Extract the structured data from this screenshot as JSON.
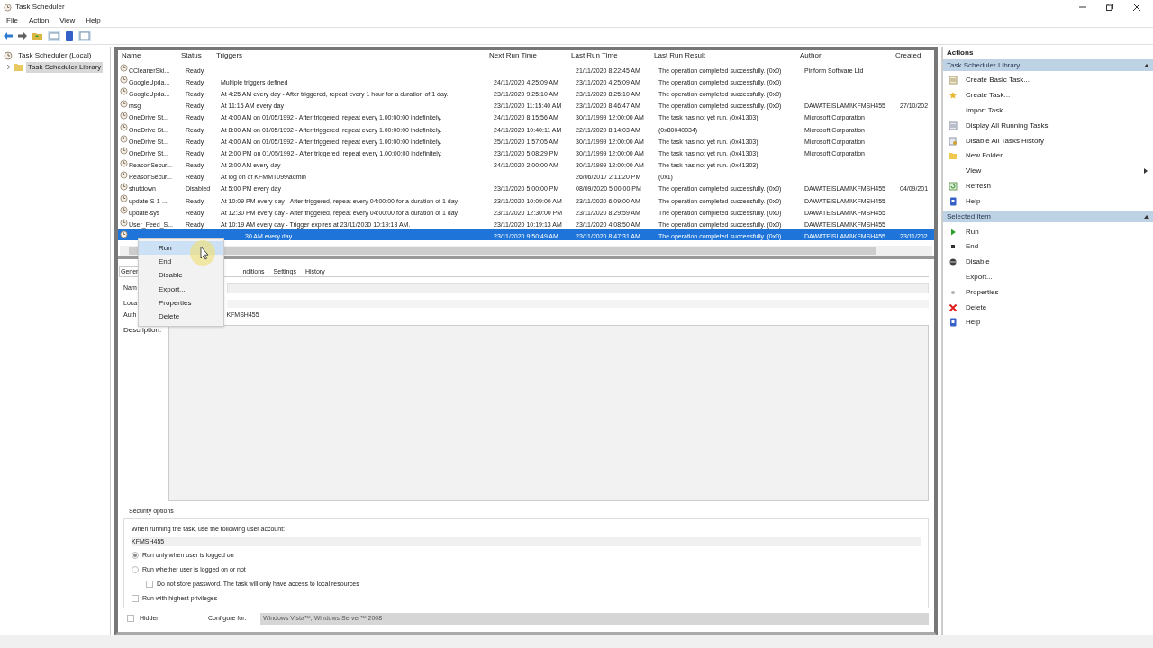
{
  "window": {
    "title": "Task Scheduler"
  },
  "menu": [
    "File",
    "Action",
    "View",
    "Help"
  ],
  "tree": [
    {
      "label": "Task Scheduler (Local)",
      "selected": false,
      "children": [
        {
          "label": "Task Scheduler Library",
          "selected": true
        }
      ]
    }
  ],
  "table": {
    "columns": [
      "Name",
      "Status",
      "Triggers",
      "Next Run Time",
      "Last Run Time",
      "Last Run Result",
      "Author",
      "Created"
    ],
    "rows": [
      {
        "selected": false,
        "cells": [
          "CCleanerSki...",
          "Ready",
          "",
          "",
          "21/11/2020 8:22:45 AM",
          "The operation completed successfully. (0x0)",
          "Piriform Software Ltd",
          ""
        ]
      },
      {
        "selected": false,
        "cells": [
          "GoogleUpda...",
          "Ready",
          "Multiple triggers defined",
          "24/11/2020 4:25:09 AM",
          "23/11/2020 4:25:09 AM",
          "The operation completed successfully. (0x0)",
          "",
          ""
        ]
      },
      {
        "selected": false,
        "cells": [
          "GoogleUpda...",
          "Ready",
          "At 4:25 AM every day - After triggered, repeat every 1 hour for a duration of 1 day.",
          "23/11/2020 9:25:10 AM",
          "23/11/2020 8:25:10 AM",
          "The operation completed successfully. (0x0)",
          "",
          ""
        ]
      },
      {
        "selected": false,
        "cells": [
          "msg",
          "Ready",
          "At 11:15 AM every day",
          "23/11/2020 11:15:40 AM",
          "23/11/2020 8:46:47 AM",
          "The operation completed successfully. (0x0)",
          "DAWATEISLAMI\\KFMSH455",
          "27/10/202"
        ]
      },
      {
        "selected": false,
        "cells": [
          "OneDrive St...",
          "Ready",
          "At 4:00 AM on 01/05/1992 - After triggered, repeat every 1.00:00:00 indefinitely.",
          "24/11/2020 8:15:56 AM",
          "30/11/1999 12:00:00 AM",
          "The task has not yet run. (0x41303)",
          "Microsoft Corporation",
          ""
        ]
      },
      {
        "selected": false,
        "cells": [
          "OneDrive St...",
          "Ready",
          "At 8:00 AM on 01/05/1992 - After triggered, repeat every 1.00:00:00 indefinitely.",
          "24/11/2020 10:40:11 AM",
          "22/11/2020 8:14:03 AM",
          "(0x80040034)",
          "Microsoft Corporation",
          ""
        ]
      },
      {
        "selected": false,
        "cells": [
          "OneDrive St...",
          "Ready",
          "At 4:00 AM on 01/05/1992 - After triggered, repeat every 1.00:00:00 indefinitely.",
          "25/11/2020 1:57:05 AM",
          "30/11/1999 12:00:00 AM",
          "The task has not yet run. (0x41303)",
          "Microsoft Corporation",
          ""
        ]
      },
      {
        "selected": false,
        "cells": [
          "OneDrive St...",
          "Ready",
          "At 2:00 PM on 01/05/1992 - After triggered, repeat every 1.00:00:00 indefinitely.",
          "23/11/2020 5:08:29 PM",
          "30/11/1999 12:00:00 AM",
          "The task has not yet run. (0x41303)",
          "Microsoft Corporation",
          ""
        ]
      },
      {
        "selected": false,
        "cells": [
          "ReasonSecur...",
          "Ready",
          "At 2:00 AM every day",
          "24/11/2020 2:00:00 AM",
          "30/11/1999 12:00:00 AM",
          "The task has not yet run. (0x41303)",
          "",
          ""
        ]
      },
      {
        "selected": false,
        "cells": [
          "ReasonSecur...",
          "Ready",
          "At log on of KFMMT099\\admin",
          "",
          "26/06/2017 2:11:20 PM",
          "(0x1)",
          "",
          ""
        ]
      },
      {
        "selected": false,
        "cells": [
          "shutdown",
          "Disabled",
          "At 5:00 PM every day",
          "23/11/2020 5:00:00 PM",
          "08/09/2020 5:00:00 PM",
          "The operation completed successfully. (0x0)",
          "DAWATEISLAMI\\KFMSH455",
          "04/09/201"
        ]
      },
      {
        "selected": false,
        "cells": [
          "update-S-1-...",
          "Ready",
          "At 10:09 PM every day - After triggered, repeat every 04:00:00 for a duration of 1 day.",
          "23/11/2020 10:09:00 AM",
          "23/11/2020 6:09:00 AM",
          "The operation completed successfully. (0x0)",
          "DAWATEISLAMI\\KFMSH455",
          ""
        ]
      },
      {
        "selected": false,
        "cells": [
          "update-sys",
          "Ready",
          "At 12:30 PM every day - After triggered, repeat every 04:00:00 for a duration of 1 day.",
          "23/11/2020 12:30:00 PM",
          "23/11/2020 8:29:59 AM",
          "The operation completed successfully. (0x0)",
          "DAWATEISLAMI\\KFMSH455",
          ""
        ]
      },
      {
        "selected": false,
        "cells": [
          "User_Feed_S...",
          "Ready",
          "At 10:19 AM every day - Trigger expires at 23/11/2030 10:19:13 AM.",
          "23/11/2020 10:19:13 AM",
          "23/11/2020 4:08:50 AM",
          "The operation completed successfully. (0x0)",
          "DAWATEISLAMI\\KFMSH455",
          ""
        ]
      },
      {
        "selected": true,
        "cells": [
          "",
          "",
          "30 AM every day",
          "23/11/2020 9:50:49 AM",
          "23/11/2020 8:47:31 AM",
          "The operation completed successfully. (0x0)",
          "DAWATEISLAMI\\KFMSH455",
          "23/11/202"
        ]
      }
    ]
  },
  "context_menu": [
    {
      "label": "Run",
      "selected": true
    },
    {
      "label": "End",
      "selected": false
    },
    {
      "label": "Disable",
      "selected": false
    },
    {
      "label": "Export...",
      "selected": false
    },
    {
      "label": "Properties",
      "selected": false
    },
    {
      "label": "Delete",
      "selected": false
    }
  ],
  "details": {
    "tabs": [
      {
        "label": "Gener",
        "selected": true
      },
      {
        "label": "nditions",
        "selected": false
      },
      {
        "label": "Settings",
        "selected": false
      },
      {
        "label": "History",
        "selected": false
      }
    ],
    "labels": [
      "Nam",
      "Loca",
      "Auth"
    ],
    "author_value": "KFMSH455",
    "description_label": "Description:",
    "security": {
      "title": "Security options",
      "prompt": "When running the task, use the following user account:",
      "account": "KFMSH455",
      "options": [
        {
          "kind": "radio",
          "label": "Run only when user is logged on",
          "selected": true,
          "indented": false
        },
        {
          "kind": "radio",
          "label": "Run whether user is logged on or not",
          "selected": false,
          "indented": false
        },
        {
          "kind": "checkbox",
          "label": "Do not store password.  The task will only have access to local resources",
          "checked": false,
          "indented": true
        },
        {
          "kind": "checkbox",
          "label": "Run with highest privileges",
          "checked": false,
          "indented": false
        }
      ]
    },
    "hidden": {
      "label": "Hidden",
      "checked": false
    },
    "configure": {
      "label": "Configure for:",
      "value": "Windows Vista™, Windows Server™ 2008",
      "disabled": true
    }
  },
  "actions": {
    "title": "Actions",
    "sections": [
      {
        "title": "Task Scheduler Library",
        "items": [
          {
            "label": "Create Basic Task...",
            "kind": "calendar"
          },
          {
            "label": "Create Task...",
            "kind": "star"
          },
          {
            "label": "Import Task...",
            "kind": "none"
          },
          {
            "label": "Display All Running Tasks",
            "kind": "list"
          },
          {
            "label": "Disable All Tasks History",
            "kind": "history"
          },
          {
            "label": "New Folder...",
            "kind": "folder"
          },
          {
            "label": "View",
            "kind": "submenu"
          },
          {
            "label": "Refresh",
            "kind": "refresh"
          },
          {
            "label": "Help",
            "kind": "help"
          }
        ]
      },
      {
        "title": "Selected Item",
        "items": [
          {
            "label": "Run",
            "kind": "run"
          },
          {
            "label": "End",
            "kind": "stop"
          },
          {
            "label": "Disable",
            "kind": "disable"
          },
          {
            "label": "Export...",
            "kind": "none"
          },
          {
            "label": "Properties",
            "kind": "dot"
          },
          {
            "label": "Delete",
            "kind": "delete"
          },
          {
            "label": "Help",
            "kind": "help"
          }
        ]
      }
    ]
  }
}
